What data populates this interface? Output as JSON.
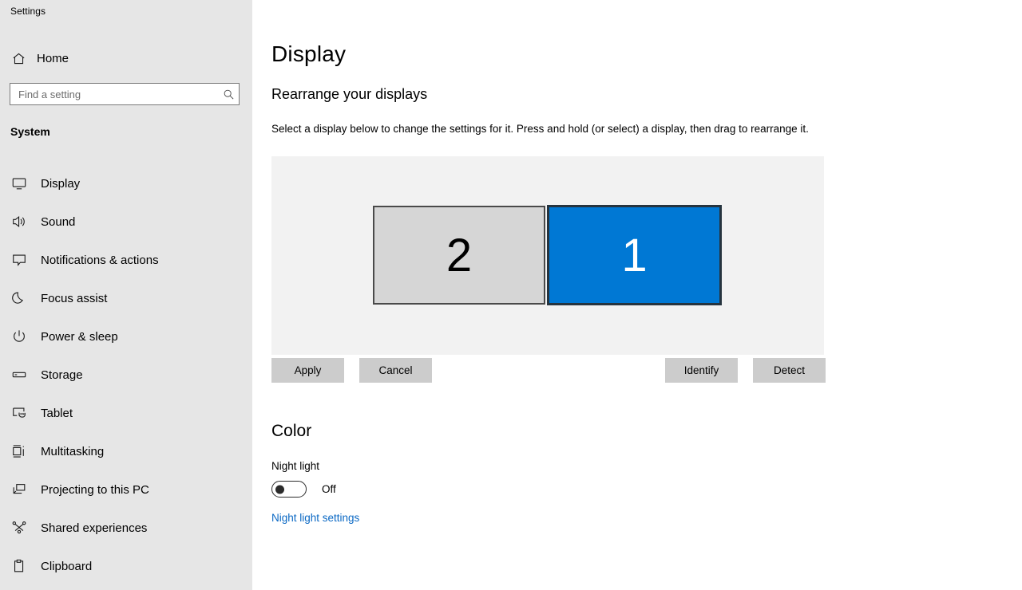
{
  "app": {
    "title": "Settings"
  },
  "sidebar": {
    "home_label": "Home",
    "home_icon": "home-icon",
    "search": {
      "placeholder": "Find a setting",
      "value": "",
      "icon": "search-icon"
    },
    "section_label": "System",
    "items": [
      {
        "label": "Display",
        "icon": "monitor-icon"
      },
      {
        "label": "Sound",
        "icon": "speaker-icon"
      },
      {
        "label": "Notifications & actions",
        "icon": "speech-bubble-icon"
      },
      {
        "label": "Focus assist",
        "icon": "moon-icon"
      },
      {
        "label": "Power & sleep",
        "icon": "power-icon"
      },
      {
        "label": "Storage",
        "icon": "drive-icon"
      },
      {
        "label": "Tablet",
        "icon": "tablet-hand-icon"
      },
      {
        "label": "Multitasking",
        "icon": "multitasking-icon"
      },
      {
        "label": "Projecting to this PC",
        "icon": "projecting-icon"
      },
      {
        "label": "Shared experiences",
        "icon": "share-nodes-icon"
      },
      {
        "label": "Clipboard",
        "icon": "clipboard-icon"
      }
    ]
  },
  "main": {
    "page_title": "Display",
    "rearrange": {
      "heading": "Rearrange your displays",
      "instruction": "Select a display below to change the settings for it. Press and hold (or select) a display, then drag to rearrange it.",
      "displays": [
        {
          "number": "2",
          "selected": false
        },
        {
          "number": "1",
          "selected": true
        }
      ],
      "buttons": {
        "apply": "Apply",
        "cancel": "Cancel",
        "identify": "Identify",
        "detect": "Detect"
      }
    },
    "color": {
      "heading": "Color",
      "night_light_label": "Night light",
      "night_light_state": "Off",
      "night_light_link": "Night light settings"
    }
  },
  "colors": {
    "sidebar_bg": "#e6e6e6",
    "content_bg": "#ffffff",
    "canvas_bg": "#f2f2f2",
    "selected_display": "#0078d4",
    "unselected_display": "#d6d6d6",
    "button_bg": "#cccccc",
    "link": "#0a68c4"
  }
}
